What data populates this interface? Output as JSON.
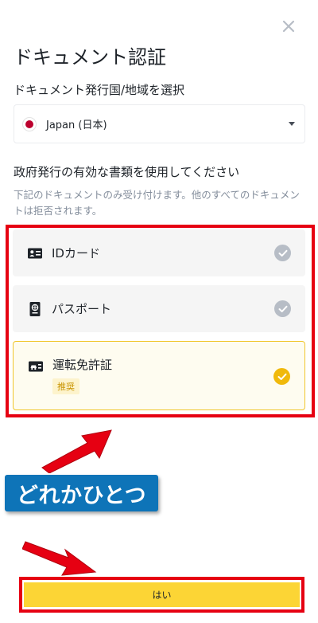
{
  "dialog": {
    "title": "ドキュメント認証",
    "close_icon": "close-icon"
  },
  "country": {
    "label": "ドキュメント発行国/地域を選択",
    "selected": "Japan (日本)",
    "flag_icon": "japan-flag-icon"
  },
  "documents": {
    "heading": "政府発行の有効な書類を使用してください",
    "note": "下記のドキュメントのみ受け付けます。他のすべてのドキュメントは拒否されます。",
    "options": [
      {
        "label": "IDカード",
        "icon": "id-card-icon",
        "selected": false
      },
      {
        "label": "パスポート",
        "icon": "passport-icon",
        "selected": false
      },
      {
        "label": "運転免許証",
        "icon": "driver-license-icon",
        "badge": "推奨",
        "selected": true
      }
    ]
  },
  "annotation": {
    "callout": "どれかひとつ"
  },
  "footer": {
    "yes_label": "はい"
  },
  "colors": {
    "accent": "#fcd535",
    "check_active": "#f0b90b",
    "check_inactive": "#b7bdc6",
    "annotation_red": "#e60012",
    "callout_blue": "#0e74b8"
  }
}
